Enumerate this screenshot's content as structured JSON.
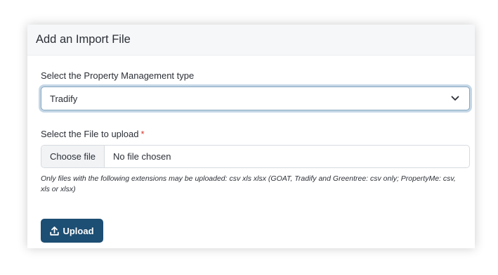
{
  "header": {
    "title": "Add an Import File"
  },
  "pm_type": {
    "label": "Select the Property Management type",
    "selected": "Tradify"
  },
  "file_upload": {
    "label": "Select the File to upload",
    "required_marker": "*",
    "choose_label": "Choose file",
    "status": "No file chosen",
    "help": "Only files with the following extensions may be uploaded: csv xls xlsx (GOAT, Tradify and Greentree: csv only; PropertyMe: csv, xls or xlsx)"
  },
  "actions": {
    "upload_label": "Upload",
    "upload_icon": "upload-icon"
  },
  "colors": {
    "primary": "#1d4e73",
    "required": "#d3392c",
    "focus_ring": "#c5d7e6"
  }
}
